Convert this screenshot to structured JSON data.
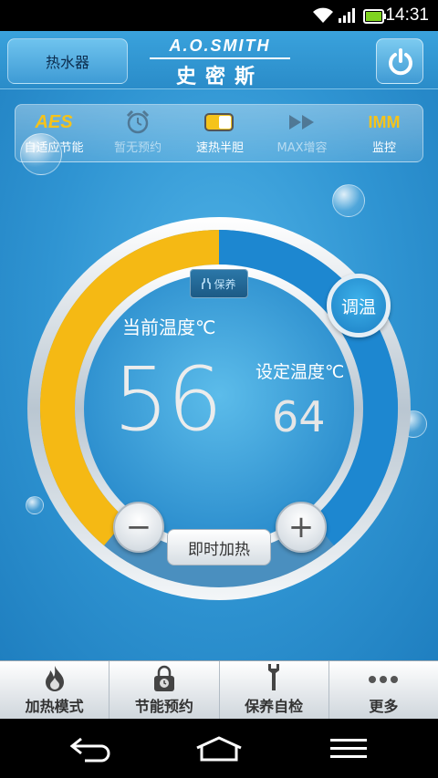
{
  "status": {
    "time": "14:31"
  },
  "header": {
    "tab_label": "热水器",
    "brand_en": "A.O.SMITH",
    "brand_cn": "史密斯"
  },
  "modes": [
    {
      "badge": "AES",
      "label": "自适应节能"
    },
    {
      "badge": "",
      "label": "暂无预约"
    },
    {
      "badge": "",
      "label": "速热半胆"
    },
    {
      "badge": "",
      "label": "MAX增容"
    },
    {
      "badge": "IMM",
      "label": "监控"
    }
  ],
  "dial": {
    "maintenance_badge": "保养",
    "current_label": "当前温度℃",
    "current_value": "56",
    "set_label": "设定温度℃",
    "set_value": "64",
    "adjust_label": "调温",
    "minus_label": "−",
    "plus_label": "+",
    "heat_now_label": "即时加热",
    "arc_fraction_yellow": 0.5
  },
  "bottom_tabs": [
    {
      "label": "加热模式",
      "icon": "flame-icon"
    },
    {
      "label": "节能预约",
      "icon": "lock-clock-icon"
    },
    {
      "label": "保养自检",
      "icon": "wrench-icon"
    },
    {
      "label": "更多",
      "icon": "more-dots-icon"
    }
  ],
  "colors": {
    "accent_yellow": "#f5b914",
    "accent_blue": "#1d87d0"
  }
}
